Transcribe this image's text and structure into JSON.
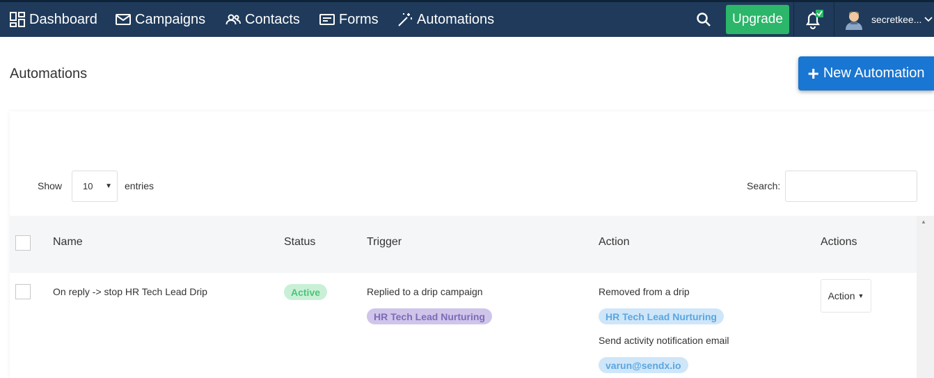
{
  "nav": {
    "items": [
      {
        "label": "Dashboard",
        "icon": "dashboard-icon"
      },
      {
        "label": "Campaigns",
        "icon": "envelope-icon"
      },
      {
        "label": "Contacts",
        "icon": "people-icon"
      },
      {
        "label": "Forms",
        "icon": "form-icon"
      },
      {
        "label": "Automations",
        "icon": "magic-wand-icon"
      }
    ],
    "upgrade_label": "Upgrade",
    "user_name": "secretkee..."
  },
  "page": {
    "title": "Automations",
    "new_button_label": "New Automation"
  },
  "table_controls": {
    "show_label": "Show",
    "entries_value": "10",
    "entries_label": "entries",
    "search_label": "Search:",
    "search_value": ""
  },
  "table": {
    "headers": [
      "Name",
      "Status",
      "Trigger",
      "Action",
      "Actions"
    ],
    "rows": [
      {
        "name": "On reply -> stop HR Tech Lead Drip",
        "status": "Active",
        "trigger_text": "Replied to a drip campaign",
        "trigger_badge": "HR Tech Lead Nurturing",
        "action_text_1": "Removed from a drip",
        "action_badge_1": "HR Tech Lead Nurturing",
        "action_text_2": "Send activity notification email",
        "action_badge_2": "varun@sendx.io",
        "actions_button": "Action"
      }
    ]
  },
  "colors": {
    "navbar": "#1f3a5a",
    "upgrade": "#2bb66a",
    "primary": "#1976d2",
    "active_badge": "#c9f0d7",
    "trigger_badge": "#cfc5ea",
    "action_badge": "#cfe6f9"
  }
}
